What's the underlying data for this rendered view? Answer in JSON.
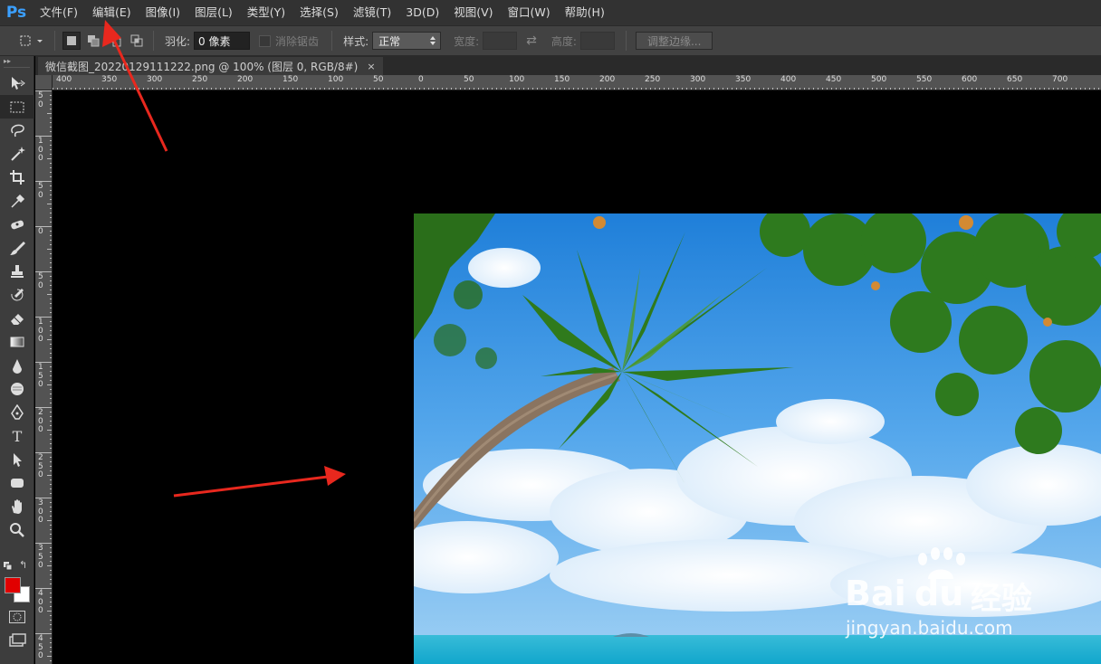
{
  "app": {
    "logo": "Ps",
    "menu": [
      "文件(F)",
      "编辑(E)",
      "图像(I)",
      "图层(L)",
      "类型(Y)",
      "选择(S)",
      "滤镜(T)",
      "3D(D)",
      "视图(V)",
      "窗口(W)",
      "帮助(H)"
    ]
  },
  "options": {
    "feather_label": "羽化:",
    "feather_value": "0 像素",
    "antialias_label": "消除锯齿",
    "style_label": "样式:",
    "style_value": "正常",
    "width_label": "宽度:",
    "height_label": "高度:",
    "refine_edge_label": "调整边缘..."
  },
  "document": {
    "tab_title": "微信截图_20220129111222.png @ 100% (图层 0, RGB/8#)",
    "close_glyph": "×"
  },
  "rulers": {
    "horizontal": [
      "400",
      "350",
      "300",
      "250",
      "200",
      "150",
      "100",
      "50",
      "0",
      "50",
      "100",
      "150",
      "200",
      "250",
      "300",
      "350",
      "400",
      "450",
      "500",
      "550",
      "600",
      "650",
      "700"
    ],
    "vertical": [
      "5 0",
      "1 0 0",
      "5 0",
      "0",
      "5 0",
      "1 0 0",
      "1 5 0",
      "2 0 0",
      "2 5 0",
      "3 0 0",
      "3 5 0",
      "4 0 0",
      "4 5 0"
    ]
  },
  "tools": [
    {
      "name": "move-tool",
      "icon": "move-icon"
    },
    {
      "name": "marquee-tool",
      "icon": "marquee-icon",
      "active": true
    },
    {
      "name": "lasso-tool",
      "icon": "lasso-icon"
    },
    {
      "name": "magic-wand-tool",
      "icon": "magic-wand-icon"
    },
    {
      "name": "crop-tool",
      "icon": "crop-icon"
    },
    {
      "name": "eyedropper-tool",
      "icon": "eyedropper-icon"
    },
    {
      "name": "healing-brush-tool",
      "icon": "bandage-icon"
    },
    {
      "name": "brush-tool",
      "icon": "brush-icon"
    },
    {
      "name": "clone-stamp-tool",
      "icon": "stamp-icon"
    },
    {
      "name": "history-brush-tool",
      "icon": "history-brush-icon"
    },
    {
      "name": "eraser-tool",
      "icon": "eraser-icon"
    },
    {
      "name": "gradient-tool",
      "icon": "gradient-icon"
    },
    {
      "name": "blur-tool",
      "icon": "blur-icon"
    },
    {
      "name": "dodge-tool",
      "icon": "dodge-icon"
    },
    {
      "name": "pen-tool",
      "icon": "pen-icon"
    },
    {
      "name": "type-tool",
      "icon": "type-icon"
    },
    {
      "name": "path-selection-tool",
      "icon": "path-arrow-icon"
    },
    {
      "name": "shape-tool",
      "icon": "rounded-rect-icon"
    },
    {
      "name": "hand-tool",
      "icon": "hand-icon"
    },
    {
      "name": "zoom-tool",
      "icon": "zoom-icon"
    }
  ],
  "type_tool_glyph": "T",
  "colors": {
    "foreground": "#e10000",
    "background": "#ffffff",
    "annotation_arrow": "#e8281e"
  },
  "watermark": {
    "brand": "Bai",
    "brand_du": "du",
    "brand_cn": "经验",
    "url": "jingyan.baidu.com"
  }
}
